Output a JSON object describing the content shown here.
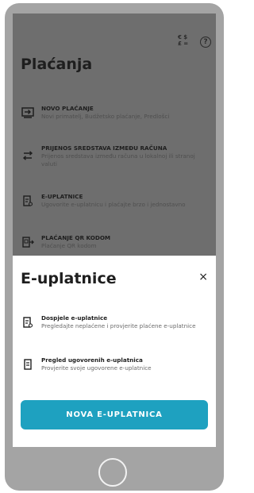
{
  "page": {
    "title": "Plaćanja",
    "help_icon_glyph": "?"
  },
  "menu": {
    "items": [
      {
        "title": "NOVO PLAĆANJE",
        "subtitle": "Novi primatelj, Budžetsko plaćanje, Predlošci"
      },
      {
        "title": "PRIJENOS SREDSTAVA IZMEĐU RAČUNA",
        "subtitle": "Prijenos sredstava između računa u lokalnoj ili stranoj valuti"
      },
      {
        "title": "E-UPLATNICE",
        "subtitle": "Ugovorite e-uplatnicu i plaćajte brzo i jednostavno"
      },
      {
        "title": "PLAĆANJE QR KODOM",
        "subtitle": "Plaćanje QR kodom"
      }
    ]
  },
  "sheet": {
    "title": "E-uplatnice",
    "close_glyph": "×",
    "items": [
      {
        "title": "Dospjele e-uplatnice",
        "subtitle": "Pregledajte neplaćene i provjerite plaćene e-uplatnice"
      },
      {
        "title": "Pregled ugovorenih e-uplatnica",
        "subtitle": "Provjerite svoje ugovorene e-uplatnice"
      }
    ],
    "button_label": "NOVA E-UPLATNICA"
  },
  "colors": {
    "accent": "#1ea1c0",
    "overlay": "#6e6e6e",
    "device": "#a4a4a4"
  },
  "icons": [
    "exchange-rate-icon",
    "help-icon",
    "new-payment-icon",
    "transfer-icon",
    "e-bill-icon",
    "qr-payment-icon",
    "close-icon",
    "due-e-bill-icon",
    "contracted-e-bill-icon"
  ]
}
